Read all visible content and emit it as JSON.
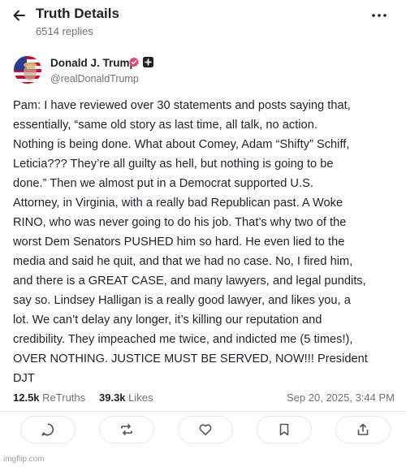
{
  "header": {
    "title": "Truth Details",
    "replies": "6514 replies"
  },
  "author": {
    "name": "Donald J. Trump",
    "handle": "@realDonaldTrump"
  },
  "post": {
    "lines": [
      "Pam: I have reviewed over 30 statements and posts saying that,",
      "essentially, “same old story as last time, all talk, no action.",
      "Nothing is being done. What about Comey, Adam “Shifty” Schiff,",
      "Leticia??? They’re all guilty as hell, but nothing is going to be",
      "done.” Then we almost put in a Democrat supported U.S.",
      "Attorney, in Virginia, with a really bad Republican past. A Woke",
      "RINO, who was never going to do his job. That’s why two of the",
      "worst Dem Senators PUSHED him so hard. He even lied to the",
      "media and said he quit, and that we had no case. No, I fired him,",
      "and there is a GREAT CASE, and many lawyers, and legal pundits,",
      "say so. Lindsey Halligan is a really good lawyer, and likes you, a",
      "lot. We can’t delay any longer, it’s killing our reputation and",
      "credibility. They impeached me twice, and indicted me (5 times!),",
      "OVER NOTHING. JUSTICE MUST BE SERVED, NOW!!! President",
      "DJT"
    ]
  },
  "stats": {
    "retruths_count": "12.5k",
    "retruths_label": "ReTruths",
    "likes_count": "39.3k",
    "likes_label": "Likes",
    "timestamp": "Sep 20, 2025, 3:44 PM"
  },
  "actions": [
    "reply",
    "retruth",
    "like",
    "bookmark",
    "share"
  ],
  "icons": {
    "back": "arrow-left-icon",
    "more": "more-horizontal-icon",
    "verified": "verified-badge-icon",
    "plus": "plus-badge-icon"
  },
  "colors": {
    "verified": "#e0487a",
    "text": "#1f2129",
    "muted": "#6b7280"
  },
  "watermark": "imgflip.com"
}
